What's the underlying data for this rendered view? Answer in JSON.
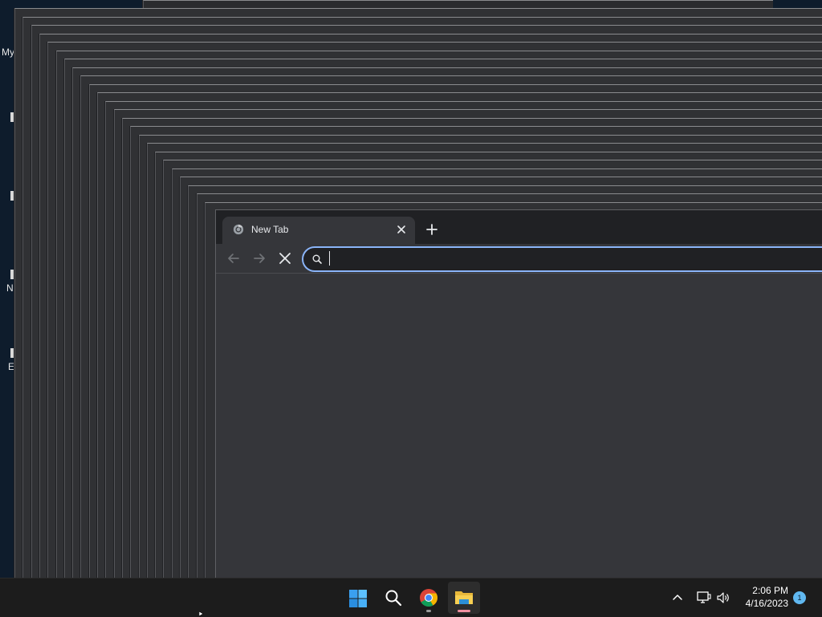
{
  "desktop": {
    "icon_labels": [
      "My",
      "N",
      "E"
    ]
  },
  "browser": {
    "tab": {
      "title": "New Tab",
      "favicon": "chrome-icon",
      "close_icon": "close-icon"
    },
    "new_tab_icon": "plus-icon",
    "toolbar": {
      "back_icon": "arrow-left-icon",
      "forward_icon": "arrow-right-icon",
      "stop_icon": "close-icon"
    },
    "omnibox": {
      "icon": "search-icon",
      "value": "",
      "placeholder": ""
    }
  },
  "taskbar": {
    "apps": [
      {
        "name": "Start",
        "icon": "windows-start-icon"
      },
      {
        "name": "Search",
        "icon": "search-icon"
      },
      {
        "name": "Google Chrome",
        "icon": "chrome-icon"
      },
      {
        "name": "File Explorer",
        "icon": "folder-icon"
      }
    ],
    "tray": {
      "chevron_icon": "chevron-up-icon",
      "network_icon": "network-icon",
      "volume_icon": "volume-icon"
    },
    "clock": {
      "time": "2:06 PM",
      "date": "4/16/2023"
    },
    "notification_count": "1"
  },
  "colors": {
    "accent": "#8ab4f8",
    "window_bg": "#35363a",
    "tabstrip_bg": "#202124",
    "taskbar_bg": "#1c1c1c",
    "explorer_indicator": "#f08fa0",
    "chrome_indicator": "#9a9a9a"
  }
}
